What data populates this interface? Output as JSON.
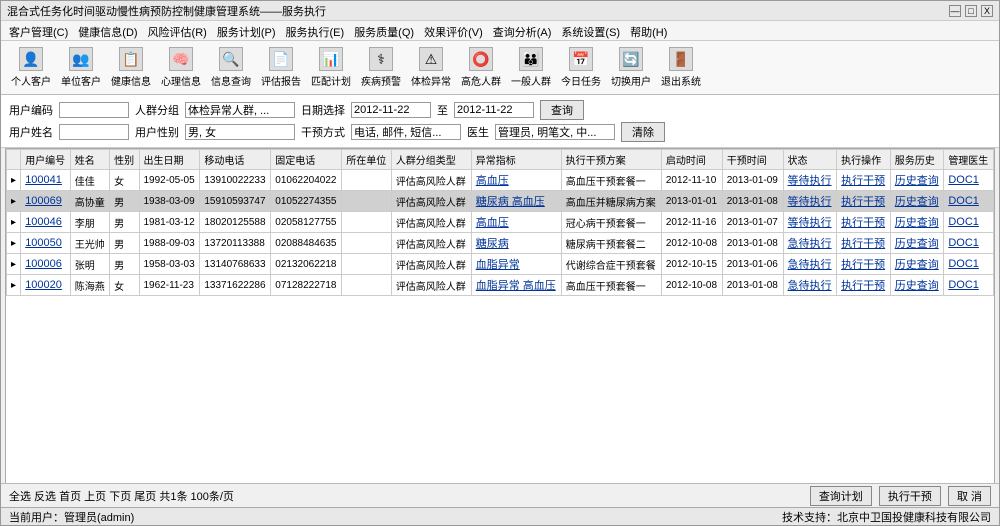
{
  "window": {
    "title": "混合式任务化时间驱动慢性病预防控制健康管理系统——服务执行",
    "min": "—",
    "max": "□",
    "close": "X"
  },
  "menus": [
    "客户管理(C)",
    "健康信息(D)",
    "风险评估(R)",
    "服务计划(P)",
    "服务执行(E)",
    "服务质量(Q)",
    "效果评价(V)",
    "查询分析(A)",
    "系统设置(S)",
    "帮助(H)"
  ],
  "toolbar": [
    {
      "icon": "👤",
      "label": "个人客户"
    },
    {
      "icon": "👥",
      "label": "单位客户"
    },
    {
      "icon": "📋",
      "label": "健康信息"
    },
    {
      "icon": "🧠",
      "label": "心理信息"
    },
    {
      "icon": "🔍",
      "label": "信息查询"
    },
    {
      "icon": "📄",
      "label": "评估报告"
    },
    {
      "icon": "📊",
      "label": "匹配计划"
    },
    {
      "icon": "⚕",
      "label": "疾病预警"
    },
    {
      "icon": "⚠",
      "label": "体检异常"
    },
    {
      "icon": "⭕",
      "label": "高危人群"
    },
    {
      "icon": "👪",
      "label": "一般人群"
    },
    {
      "icon": "📅",
      "label": "今日任务"
    },
    {
      "icon": "🔄",
      "label": "切换用户"
    },
    {
      "icon": "🚪",
      "label": "退出系统"
    }
  ],
  "filters": {
    "userCodeLabel": "用户编码",
    "userNameLabel": "用户姓名",
    "groupLabel": "人群分组",
    "groupValue": "体检异常人群, ...",
    "genderLabel": "用户性别",
    "genderValue": "男, 女",
    "dateLabel": "日期选择",
    "dateFrom": "2012-11-22",
    "dateTo": "2012-11-22",
    "toLabel": "至",
    "methodLabel": "干预方式",
    "methodValue": "电话, 邮件, 短信...",
    "doctorLabel": "医生",
    "doctorValue": "管理员, 明笔文, 中...",
    "queryBtn": "查询",
    "clearBtn": "清除"
  },
  "columns": [
    "",
    "用户编号",
    "姓名",
    "性别",
    "出生日期",
    "移动电话",
    "固定电话",
    "所在单位",
    "人群分组类型",
    "异常指标",
    "执行干预方案",
    "启动时间",
    "干预时间",
    "状态",
    "执行操作",
    "服务历史",
    "管理医生"
  ],
  "rows": [
    {
      "id": "100041",
      "name": "佳佳",
      "sex": "女",
      "dob": "1992-05-05",
      "mobile": "13910022233",
      "tel": "01062204022",
      "unit": "",
      "type": "评估高风险人群",
      "abn": "高血压",
      "plan": "高血压干预套餐一",
      "start": "2012-11-10",
      "itime": "2013-01-09",
      "status": "等待执行",
      "op": "执行干预",
      "hist": "历史查询",
      "doc": "DOC1"
    },
    {
      "id": "100069",
      "name": "高协童",
      "sex": "男",
      "dob": "1938-03-09",
      "mobile": "15910593747",
      "tel": "01052274355",
      "unit": "",
      "type": "评估高风险人群",
      "abn": "糖尿病 高血压",
      "plan": "高血压并糖尿病方案",
      "start": "2013-01-01",
      "itime": "2013-01-08",
      "status": "等待执行",
      "op": "执行干预",
      "hist": "历史查询",
      "doc": "DOC1",
      "sel": true
    },
    {
      "id": "100046",
      "name": "李朋",
      "sex": "男",
      "dob": "1981-03-12",
      "mobile": "18020125588",
      "tel": "02058127755",
      "unit": "",
      "type": "评估高风险人群",
      "abn": "高血压",
      "plan": "冠心病干预套餐一",
      "start": "2012-11-16",
      "itime": "2013-01-07",
      "status": "等待执行",
      "op": "执行干预",
      "hist": "历史查询",
      "doc": "DOC1"
    },
    {
      "id": "100050",
      "name": "王光帅",
      "sex": "男",
      "dob": "1988-09-03",
      "mobile": "13720113388",
      "tel": "02088484635",
      "unit": "",
      "type": "评估高风险人群",
      "abn": "糖尿病",
      "plan": "糖尿病干预套餐二",
      "start": "2012-10-08",
      "itime": "2013-01-08",
      "status": "急待执行",
      "op": "执行干预",
      "hist": "历史查询",
      "doc": "DOC1"
    },
    {
      "id": "100006",
      "name": "张明",
      "sex": "男",
      "dob": "1958-03-03",
      "mobile": "13140768633",
      "tel": "02132062218",
      "unit": "",
      "type": "评估高风险人群",
      "abn": "血脂异常",
      "plan": "代谢综合症干预套餐",
      "start": "2012-10-15",
      "itime": "2013-01-06",
      "status": "急待执行",
      "op": "执行干预",
      "hist": "历史查询",
      "doc": "DOC1"
    },
    {
      "id": "100020",
      "name": "陈海燕",
      "sex": "女",
      "dob": "1962-11-23",
      "mobile": "13371622286",
      "tel": "07128222718",
      "unit": "",
      "type": "评估高风险人群",
      "abn": "血脂异常 高血压",
      "plan": "高血压干预套餐一",
      "start": "2012-10-08",
      "itime": "2013-01-08",
      "status": "急待执行",
      "op": "执行干预",
      "hist": "历史查询",
      "doc": "DOC1"
    }
  ],
  "pager": {
    "links": "全选 反选 首页 上页 下页 尾页 共1条 100条/页",
    "viewPlan": "查询计划",
    "exec": "执行干预",
    "cancel": "取 消"
  },
  "status": {
    "left": "当前用户：管理员(admin)",
    "right": "技术支持：北京中卫国投健康科技有限公司"
  }
}
